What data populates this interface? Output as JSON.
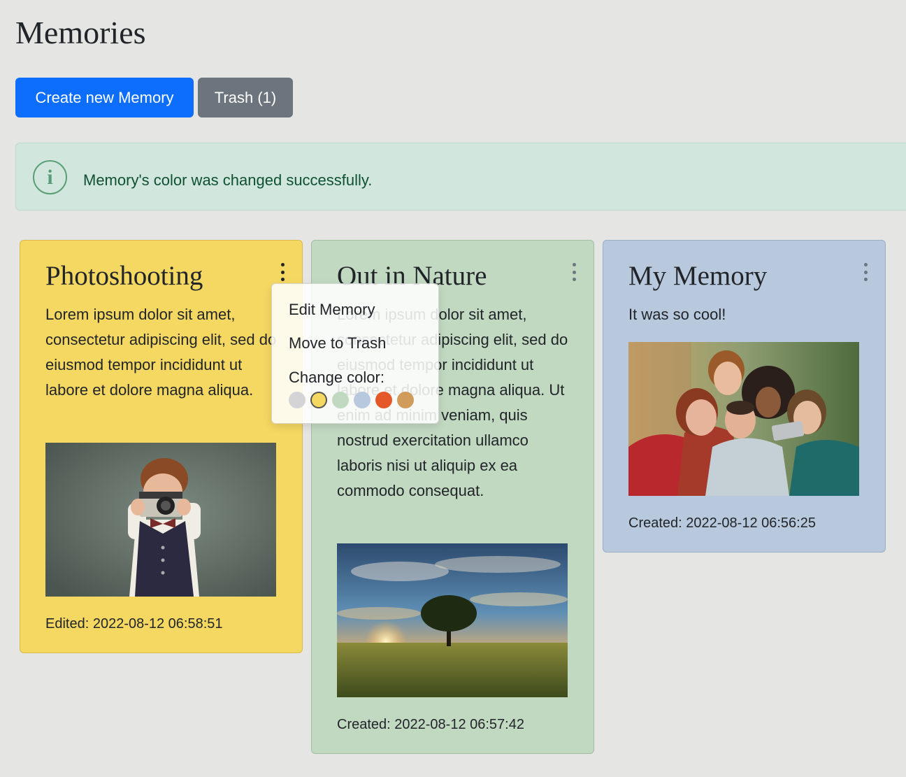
{
  "page": {
    "title": "Memories"
  },
  "toolbar": {
    "create_label": "Create new Memory",
    "trash_label": "Trash (1)"
  },
  "alert": {
    "icon": "info-icon",
    "icon_glyph": "i",
    "message": "Memory's color was changed successfully."
  },
  "colors": {
    "primary": "#0d6efd",
    "secondary": "#6c757d",
    "alert_bg": "#d1e7dd",
    "swatches": [
      "#d4d4d6",
      "#f5d862",
      "#c2d9c1",
      "#b8c9de",
      "#e5582a",
      "#d09c5c"
    ]
  },
  "cards": [
    {
      "title": "Photoshooting",
      "text": "Lorem ipsum dolor sit amet, consectetur adipiscing elit, sed do eiusmod tempor incididunt ut labore et dolore magna aliqua.",
      "image": "child-with-camera",
      "footer": "Edited: 2022-08-12 06:58:51",
      "color": "#f5d862"
    },
    {
      "title": "Out in Nature",
      "text": "Lorem ipsum dolor sit amet, consectetur adipiscing elit, sed do eiusmod tempor incididunt ut labore et dolore magna aliqua. Ut enim ad minim veniam, quis nostrud exercitation ullamco laboris nisi ut aliquip ex ea commodo consequat.",
      "image": "tree-at-sunset",
      "footer": "Created: 2022-08-12 06:57:42",
      "color": "#c2d9c1"
    },
    {
      "title": "My Memory",
      "text": "It was so cool!",
      "image": "group-selfie",
      "footer": "Created: 2022-08-12 06:56:25",
      "color": "#b8c9de"
    }
  ],
  "dropdown": {
    "edit_label": "Edit Memory",
    "trash_label": "Move to Trash",
    "color_label": "Change color:",
    "selected_swatch": 1
  }
}
